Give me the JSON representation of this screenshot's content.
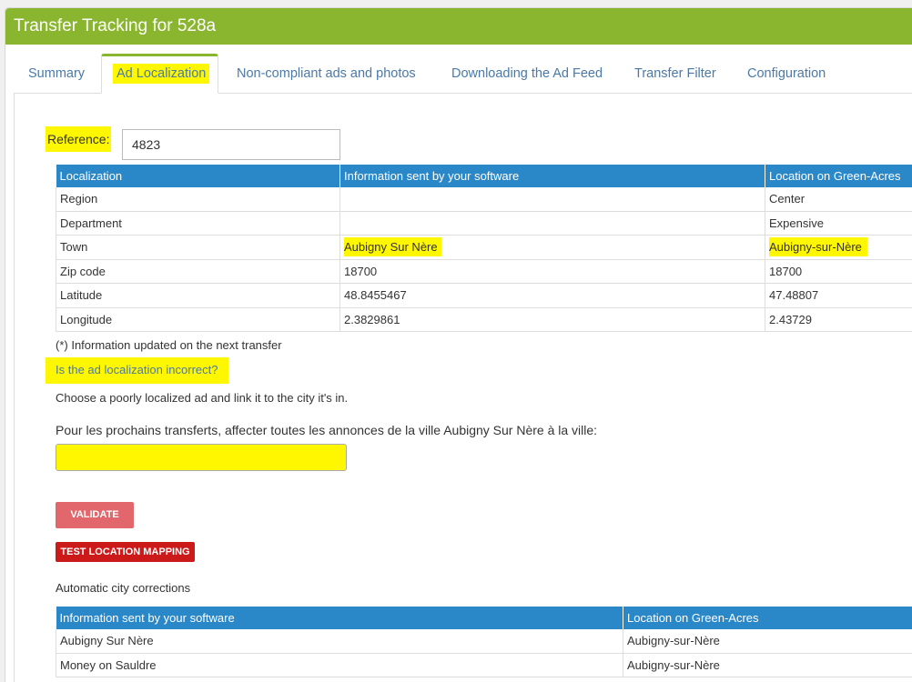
{
  "header": {
    "title": "Transfer Tracking for 528a"
  },
  "tabs": [
    {
      "label": "Summary"
    },
    {
      "label": "Ad Localization"
    },
    {
      "label": "Non-compliant ads and photos"
    },
    {
      "label": "Downloading the Ad Feed"
    },
    {
      "label": "Transfer Filter"
    },
    {
      "label": "Configuration"
    }
  ],
  "active_tab": "Ad Localization",
  "reference": {
    "label": "Reference:",
    "value": "4823"
  },
  "localization_table": {
    "headers": [
      "Localization",
      "Information sent by your software",
      "Location on Green-Acres"
    ],
    "rows": [
      [
        "Region",
        "",
        "Center"
      ],
      [
        "Department",
        "",
        "Expensive"
      ],
      [
        "Town",
        "Aubigny Sur Nère",
        "Aubigny-sur-Nère"
      ],
      [
        "Zip code",
        "18700",
        "18700"
      ],
      [
        "Latitude",
        "48.8455467",
        "47.48807"
      ],
      [
        "Longitude",
        "2.3829861",
        "2.43729"
      ]
    ]
  },
  "note": "(*) Information updated on the next transfer",
  "incorrect_link": "Is the ad localization incorrect?",
  "choose_text": "Choose a poorly localized ad and link it to the city it's in.",
  "assign_text": "Pour les prochains transferts, affecter toutes les annonces de la ville Aubigny Sur Nère à la ville:",
  "city_input": {
    "value": ""
  },
  "buttons": {
    "validate": "VALIDATE",
    "test_mapping": "TEST LOCATION MAPPING"
  },
  "auto_corrections": {
    "title": "Automatic city corrections",
    "headers": [
      "Information sent by your software",
      "Location on Green-Acres"
    ],
    "rows": [
      [
        "Aubigny Sur Nère",
        "Aubigny-sur-Nère"
      ],
      [
        "Money on Sauldre",
        "Aubigny-sur-Nère"
      ]
    ]
  },
  "colors": {
    "header_green": "#8ab52f",
    "table_header_blue": "#2a87c8",
    "highlight_yellow": "#fff700",
    "link_blue": "#4a79a7",
    "validate_red": "#e2676d",
    "test_red": "#cc1a1a"
  }
}
